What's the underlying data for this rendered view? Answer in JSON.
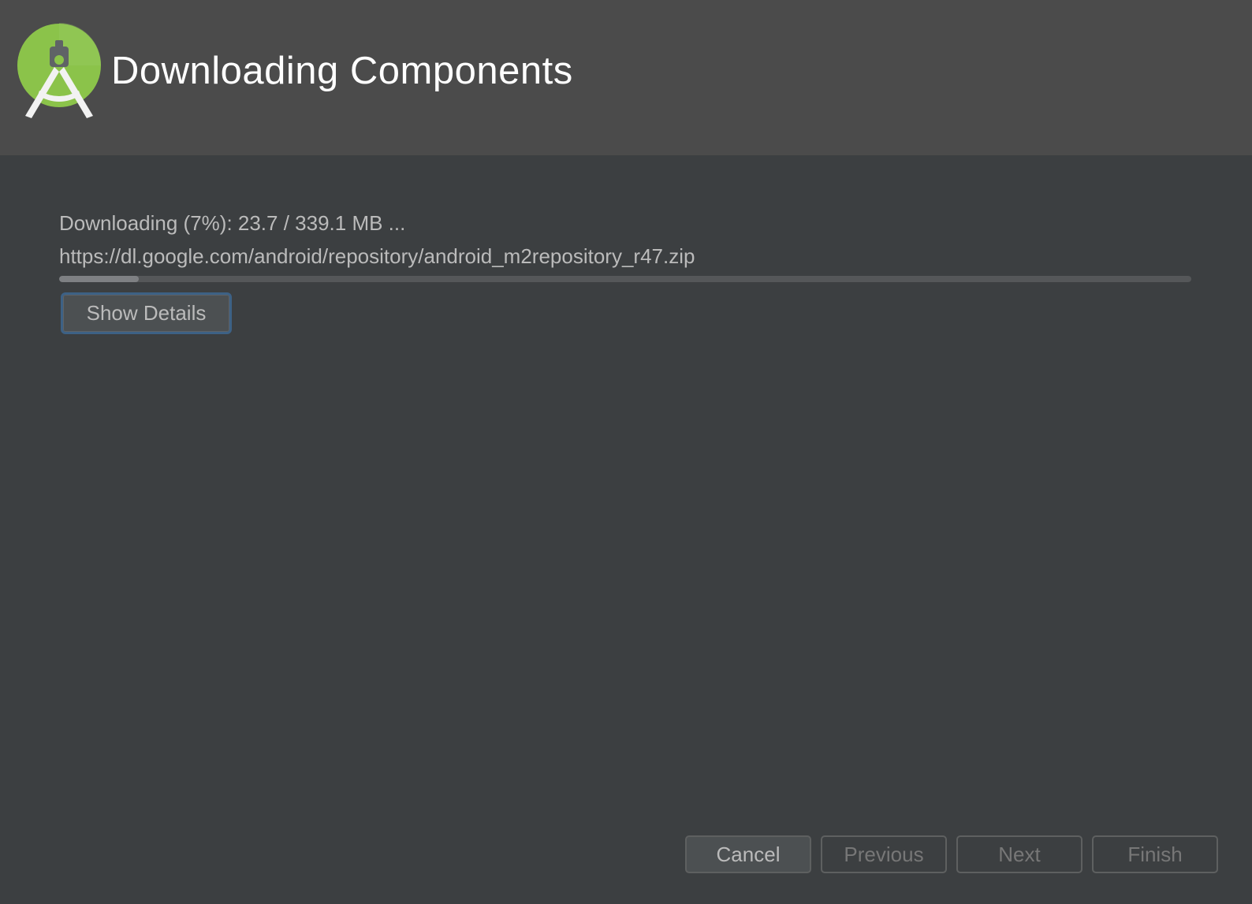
{
  "window": {
    "title": "Downloading Components"
  },
  "download": {
    "status_text": "Downloading (7%): 23.7 / 339.1 MB ...",
    "url": "https://dl.google.com/android/repository/android_m2repository_r47.zip",
    "progress_fraction": 0.07
  },
  "details": {
    "show_details_label": "Show Details"
  },
  "footer": {
    "cancel_label": "Cancel",
    "previous_label": "Previous",
    "next_label": "Next",
    "finish_label": "Finish"
  },
  "icons": {
    "logo": "android-studio-logo-icon"
  },
  "colors": {
    "header_bg": "#4b4b4b",
    "body_bg": "#3c3f41",
    "logo_green": "#8bc34a",
    "focus_border": "#3d6185"
  }
}
